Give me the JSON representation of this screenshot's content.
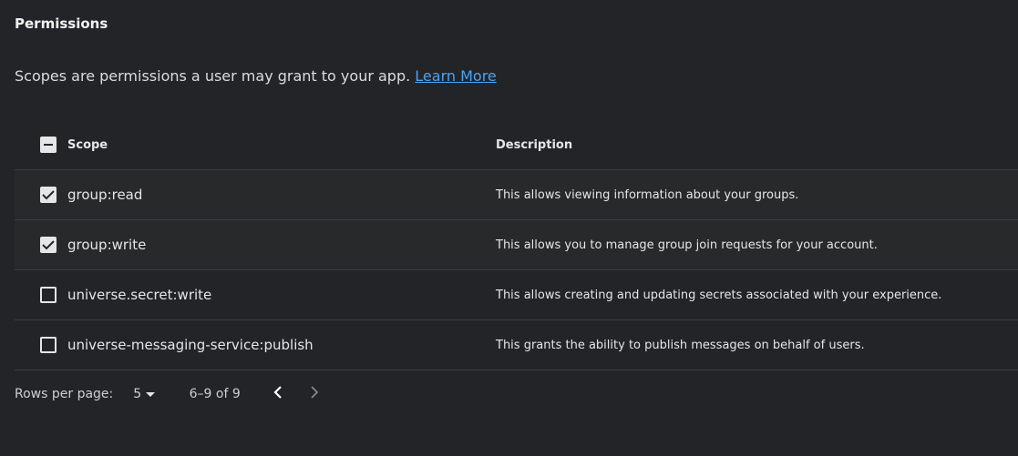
{
  "title": "Permissions",
  "description": "Scopes are permissions a user may grant to your app.",
  "learn_more": "Learn More",
  "table": {
    "headers": {
      "scope": "Scope",
      "description": "Description"
    },
    "rows": [
      {
        "scope": "group:read",
        "description": "This allows viewing information about your groups.",
        "checked": true
      },
      {
        "scope": "group:write",
        "description": "This allows you to manage group join requests for your account.",
        "checked": true
      },
      {
        "scope": "universe.secret:write",
        "description": "This allows creating and updating secrets associated with your experience.",
        "checked": false
      },
      {
        "scope": "universe-messaging-service:publish",
        "description": "This grants the ability to publish messages on behalf of users.",
        "checked": false
      }
    ]
  },
  "pagination": {
    "rows_label": "Rows per page:",
    "rows_value": "5",
    "range": "6–9 of 9"
  }
}
